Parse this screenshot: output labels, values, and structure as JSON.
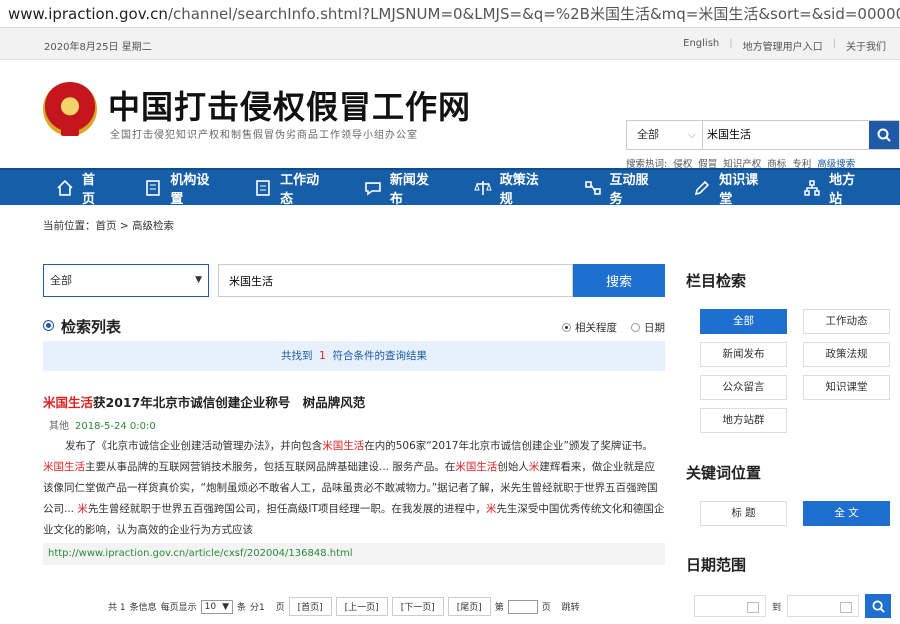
{
  "browser": {
    "url_host": "www.ipraction.gov.cn",
    "url_path": "/channel/searchInfo.shtml?LMJSNUM=0&LMJS=&q=%2B米国生活&mq=米国生活&sort=&sid=0000000"
  },
  "topbar": {
    "date": "2020年8月25日 星期二",
    "english": "English",
    "local_login": "地方管理用户入口",
    "about": "关于我们"
  },
  "header": {
    "title": "中国打击侵权假冒工作网",
    "subtitle": "全国打击侵犯知识产权和制售假冒伪劣商品工作领导小组办公室",
    "search_scope": "全部",
    "search_value": "米国生活",
    "hot_label": "搜索热词:",
    "hot_words": [
      "侵权",
      "假冒",
      "知识产权",
      "商标",
      "专利"
    ],
    "advanced": "高级搜索"
  },
  "nav": [
    "首  页",
    "机构设置",
    "工作动态",
    "新闻发布",
    "政策法规",
    "互动服务",
    "知识课堂",
    "地方站"
  ],
  "breadcrumb": "当前位置：首页 > 高级检索",
  "searchbar": {
    "scope": "全部",
    "keyword": "米国生活",
    "button": "搜索"
  },
  "list": {
    "title": "检索列表",
    "sort_relevance": "相关程度",
    "sort_date": "日期",
    "found_prefix": "共找到",
    "found_count": "1",
    "found_suffix": "符合条件的查询结果"
  },
  "result": {
    "title_hl": "米国生活",
    "title_rest": "获2017年北京市诚信创建企业称号　树品牌风范",
    "category": "其他",
    "date": "2018-5-24 0:0:0",
    "b1": "发布了《北京市诚信企业创建活动管理办法》，并向包含",
    "b2": "米国生活",
    "b3": "在内的506家“2017年北京市诚信创建企业”颁发了奖牌证书。　",
    "b4": "米国生活",
    "b5": "主要从事品牌的互联网营销技术服务，包括互联网品牌基础建设... 服务产品。在",
    "b6": "米国生活",
    "b7": "创始人",
    "b8": "米",
    "b9": "建辉看来，做企业就是应该像同仁堂做产品一样货真价实，“炮制虽烦必不敢省人工，品味虽贵必不敢减物力。”据记者了解，米先生曾经就职于世界五百强跨国公司... ",
    "b10": "米",
    "b11": "先生曾经就职于世界五百强跨国公司，担任高级IT项目经理一职。在我发展的进程中，",
    "b12": "米",
    "b13": "先生深受中国优秀传统文化和德国企业文化的影响，认为高效的企业行为方式应该",
    "url": "http://www.ipraction.gov.cn/article/cxsf/202004/136848.html"
  },
  "pager": {
    "total": "共 1",
    "unit": "条信息",
    "per_label": "每页显示",
    "per": "10",
    "per_unit": "条",
    "pages": "分1",
    "page_unit": "页",
    "first": "[首页]",
    "prev": "[上一页]",
    "next": "[下一页]",
    "last": "[尾页]",
    "goto": "第",
    "goto_unit": "页",
    "jump": "跳转"
  },
  "sidebar": {
    "col_title": "栏目检索",
    "cats": [
      "全部",
      "工作动态",
      "新闻发布",
      "政策法规",
      "公众留言",
      "知识课堂",
      "地方站群"
    ],
    "kw_title": "关键词位置",
    "kw_opts": [
      "标 题",
      "全 文"
    ],
    "date_title": "日期范围",
    "date_to": "到"
  },
  "colors": {
    "nav": "#175ea8",
    "accent": "#1e6fce",
    "highlight": "#d22222"
  }
}
